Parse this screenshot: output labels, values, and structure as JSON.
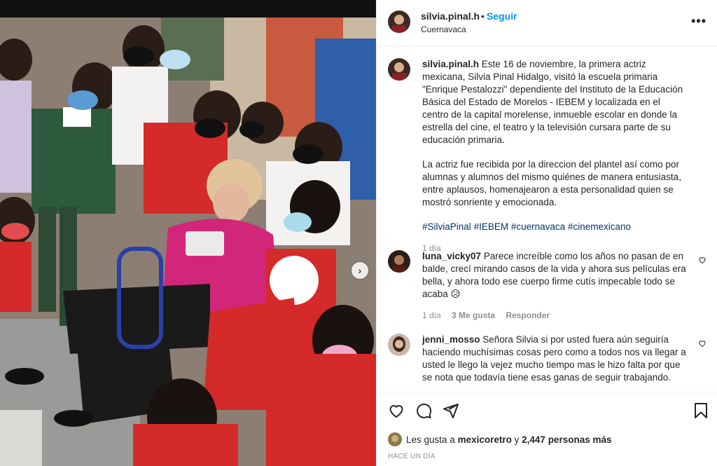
{
  "post": {
    "username": "silvia.pinal.h",
    "separator": "•",
    "follow_label": "Seguir",
    "location": "Cuernavaca",
    "more_label": "•••"
  },
  "caption": {
    "username": "silvia.pinal.h",
    "para1": "Este 16 de noviembre, la primera actriz mexicana, Silvia Pinal Hidalgo, visitó la escuela primaria \"Enrique Pestalozzi\" dependiente del Instituto de la Educación Básica del Estado de Morelos - IEBEM y localizada en el centro de la capital morelense, inmueble escolar en donde la estrella del cine, el teatro y la televisión cursara parte de su educación primaria.",
    "para2": "La actriz fue recibida por la direccion del plantel así como por alumnas y alumnos del mismo quiénes de manera entusiasta, entre aplausos, homenajearon a esta personalidad quien se mostró sonriente y emocionada.",
    "hashtags": [
      "#SilviaPinal",
      "#IEBEM",
      "#cuernavaca",
      "#cinemexicano"
    ],
    "time": "1 día"
  },
  "comments": [
    {
      "username": "luna_vicky07",
      "text": "Parece increíble como los años no pasan de en balde, crecí mirando casos de la vida y ahora sus películas era bella, y ahora todo ese cuerpo firme cutís impecable todo se acaba 😥",
      "time": "1 día",
      "likes": "3 Me gusta",
      "reply": "Responder"
    },
    {
      "username": "jenni_mosso",
      "text": "Señora Silvia si por usted fuera aún seguiría haciendo muchísimas cosas pero como a todos nos va llegar a usted le llego la vejez mucho tiempo mas le hizo falta por que se nota que todavía tiene esas ganas de seguir trabajando."
    }
  ],
  "likes": {
    "prefix": "Les gusta a",
    "user": "mexicoretro",
    "joiner": "y",
    "others": "2,447 personas más"
  },
  "posted_ago": "HACE UN DÍA",
  "photo": {
    "next_label": "›"
  },
  "icons": {
    "like": "heart-icon",
    "comment": "comment-icon",
    "share": "share-icon",
    "save": "bookmark-icon"
  },
  "colors": {
    "follow_blue": "#0095f6",
    "hashtag_blue": "#00376b",
    "muted": "#8e8e8e"
  }
}
